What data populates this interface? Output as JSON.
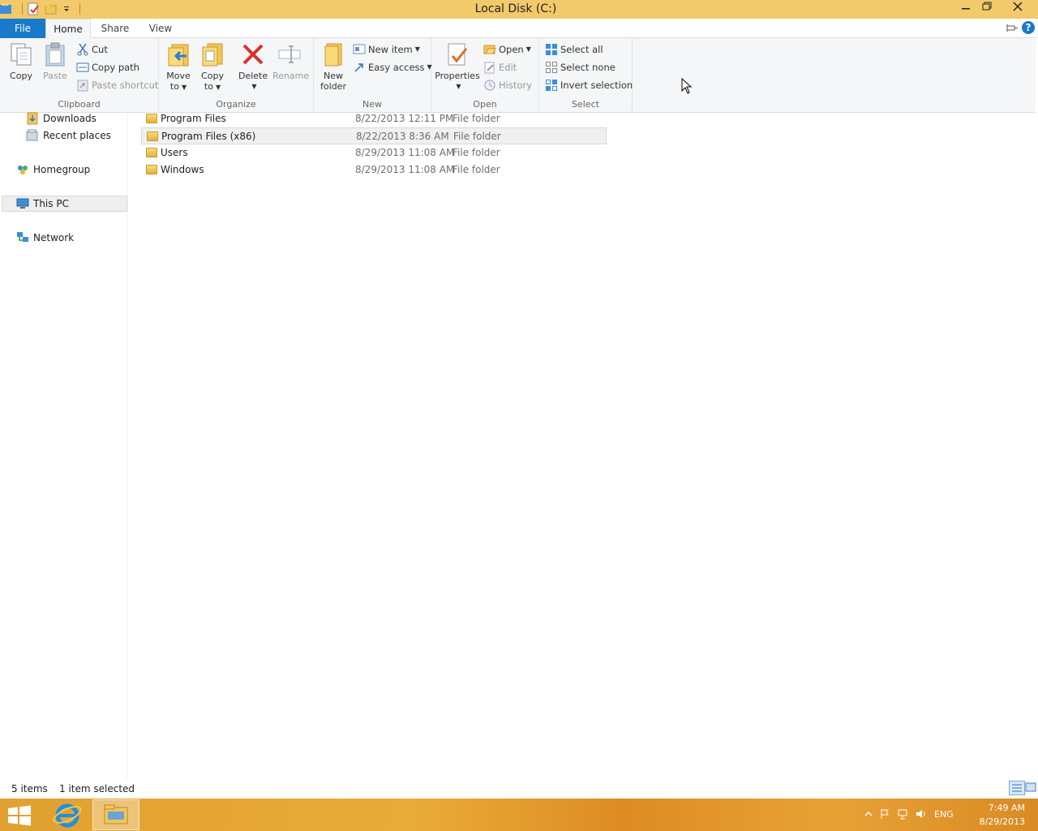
{
  "window": {
    "title": "Local Disk (C:)"
  },
  "ribbon": {
    "tabs": [
      "File",
      "Home",
      "Share",
      "View"
    ],
    "clipboard": {
      "label": "Clipboard",
      "copy": "Copy",
      "paste": "Paste",
      "cut": "Cut",
      "copy_path": "Copy path",
      "paste_shortcut": "Paste shortcut"
    },
    "organize": {
      "label": "Organize",
      "move_to_1": "Move",
      "move_to_2": "to",
      "copy_to_1": "Copy",
      "copy_to_2": "to",
      "delete": "Delete",
      "rename": "Rename"
    },
    "new": {
      "label": "New",
      "new_folder_1": "New",
      "new_folder_2": "folder",
      "new_item": "New item",
      "easy_access": "Easy access"
    },
    "open": {
      "label": "Open",
      "properties": "Properties",
      "open": "Open",
      "edit": "Edit",
      "history": "History"
    },
    "select": {
      "label": "Select",
      "select_all": "Select all",
      "select_none": "Select none",
      "invert_selection": "Invert selection"
    }
  },
  "nav": {
    "items": [
      {
        "label": "Downloads",
        "icon": "downloads-icon"
      },
      {
        "label": "Recent places",
        "icon": "recent-places-icon"
      },
      {
        "label": "Homegroup",
        "icon": "homegroup-icon"
      },
      {
        "label": "This PC",
        "icon": "this-pc-icon"
      },
      {
        "label": "Network",
        "icon": "network-icon"
      }
    ]
  },
  "files": [
    {
      "name": "Program Files",
      "date": "8/22/2013 12:11 PM",
      "type": "File folder"
    },
    {
      "name": "Program Files (x86)",
      "date": "8/22/2013 8:36 AM",
      "type": "File folder",
      "selected": true
    },
    {
      "name": "Users",
      "date": "8/29/2013 11:08 AM",
      "type": "File folder"
    },
    {
      "name": "Windows",
      "date": "8/29/2013 11:08 AM",
      "type": "File folder"
    }
  ],
  "status": {
    "item_count": "5 items",
    "selection": "1 item selected"
  },
  "taskbar": {
    "lang": "ENG",
    "time": "7:49 AM",
    "date": "8/29/2013"
  },
  "colors": {
    "title_bar": "#f2c96b",
    "file_tab": "#1979ca",
    "taskbar": "#e1a130"
  }
}
